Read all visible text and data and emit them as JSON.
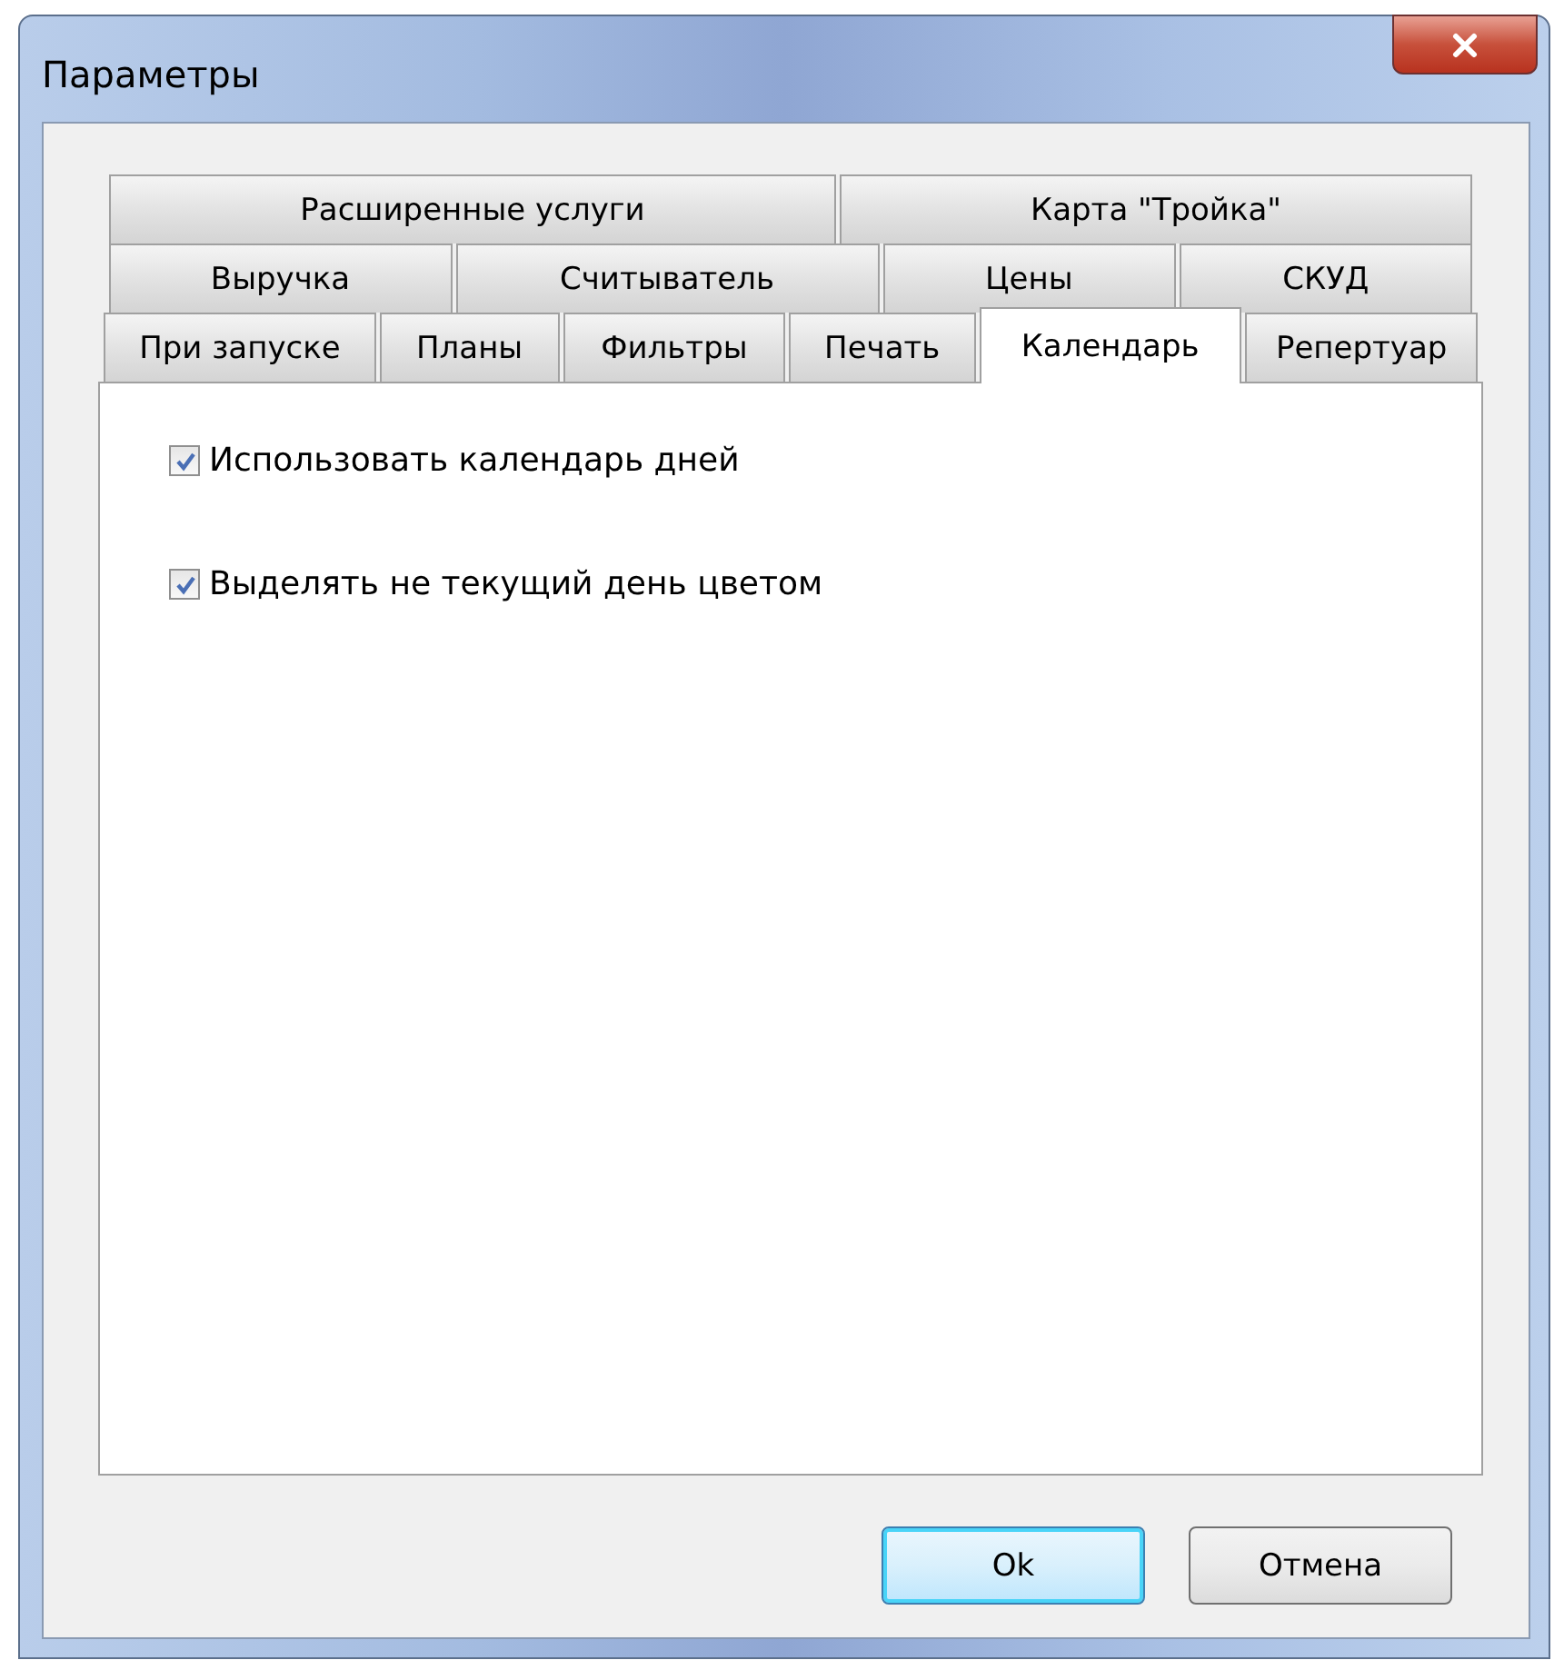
{
  "window": {
    "title": "Параметры"
  },
  "tab_rows": [
    [
      {
        "label": "Расширенные услуги",
        "selected": false
      },
      {
        "label": "Карта \"Тройка\"",
        "selected": false
      }
    ],
    [
      {
        "label": "Выручка",
        "selected": false
      },
      {
        "label": "Считыватель",
        "selected": false
      },
      {
        "label": "Цены",
        "selected": false
      },
      {
        "label": "СКУД",
        "selected": false
      }
    ],
    [
      {
        "label": "При запуске",
        "selected": false
      },
      {
        "label": "Планы",
        "selected": false
      },
      {
        "label": "Фильтры",
        "selected": false
      },
      {
        "label": "Печать",
        "selected": false
      },
      {
        "label": "Календарь",
        "selected": true
      },
      {
        "label": "Репертуар",
        "selected": false
      }
    ]
  ],
  "options": [
    {
      "label": "Использовать календарь дней",
      "checked": true
    },
    {
      "label": "Выделять не текущий день цветом",
      "checked": true
    }
  ],
  "buttons": [
    {
      "label": "Ok",
      "default": true
    },
    {
      "label": "Отмена",
      "default": false
    }
  ]
}
